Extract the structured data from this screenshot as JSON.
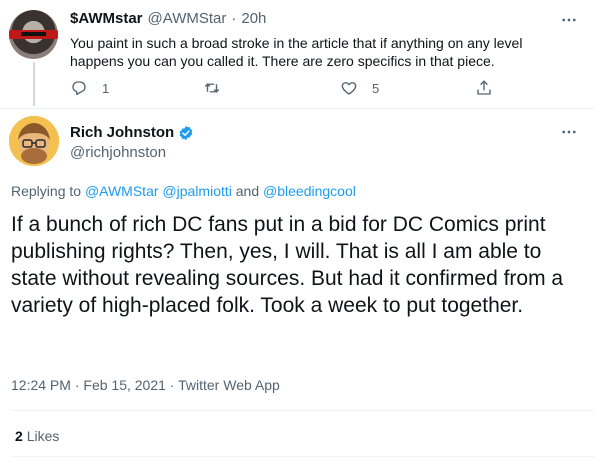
{
  "reply_tweet": {
    "display_name": "$AWMstar",
    "handle": "@AWMStar",
    "separator": "·",
    "time": "20h",
    "text": "You paint in such a broad stroke in the article that if anything on any level happens you can you called it.   There are zero specifics in that piece.",
    "reply_count": "1",
    "retweet_count": "",
    "like_count": "5"
  },
  "main_tweet": {
    "display_name": "Rich Johnston",
    "handle": "@richjohnston",
    "replying_prefix": "Replying to",
    "replying_user1": "@AWMStar",
    "replying_user2": "@jpalmiotti",
    "replying_and": "and",
    "replying_user3": "@bleedingcool",
    "text": "If a bunch of rich DC fans put in a bid for DC Comics print publishing rights? Then, yes, I will. That is all I am able to state without revealing sources. But had it confirmed from a variety of high-placed folk. Took a week to put together.",
    "time": "12:24 PM",
    "date": "Feb 15, 2021",
    "source": "Twitter Web App",
    "likes_count": "2",
    "likes_label": "Likes"
  },
  "colors": {
    "accent": "#1d9bf0",
    "muted": "#536471",
    "text": "#0f1419"
  },
  "icons": [
    "reply-icon",
    "retweet-icon",
    "like-icon",
    "share-icon",
    "more-icon",
    "verified-badge-icon"
  ]
}
